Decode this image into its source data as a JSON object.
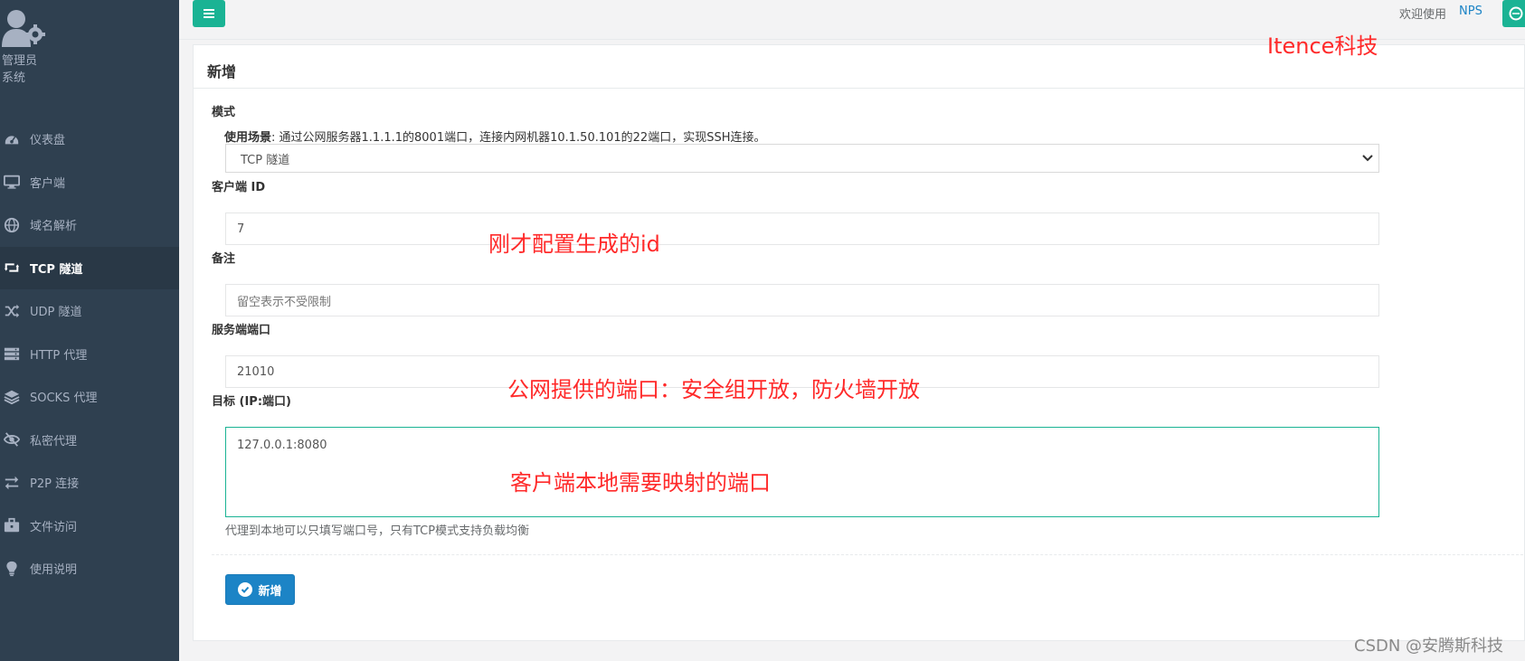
{
  "sidebar": {
    "role_line1": "管理员",
    "role_line2": "系统",
    "items": [
      {
        "label": "仪表盘",
        "icon": "dashboard-icon"
      },
      {
        "label": "客户端",
        "icon": "monitor-icon"
      },
      {
        "label": "域名解析",
        "icon": "globe-icon"
      },
      {
        "label": "TCP 隧道",
        "icon": "retweet-icon"
      },
      {
        "label": "UDP 隧道",
        "icon": "shuffle-icon"
      },
      {
        "label": "HTTP 代理",
        "icon": "server-icon"
      },
      {
        "label": "SOCKS 代理",
        "icon": "layers-icon"
      },
      {
        "label": "私密代理",
        "icon": "eye-slash-icon"
      },
      {
        "label": "P2P 连接",
        "icon": "exchange-icon"
      },
      {
        "label": "文件访问",
        "icon": "briefcase-icon"
      },
      {
        "label": "使用说明",
        "icon": "lightbulb-icon"
      }
    ],
    "active_index": 3
  },
  "topbar": {
    "welcome": "欢迎使用",
    "brand_link": "NPS"
  },
  "panel": {
    "title": "新增",
    "mode_label": "模式",
    "scene_label": "使用场景",
    "scene_text": ": 通过公网服务器1.1.1.1的8001端口，连接内网机器10.1.50.101的22端口，实现SSH连接。",
    "mode_value": "TCP 隧道",
    "client_id_label": "客户端 ID",
    "client_id_value": "7",
    "remark_label": "备注",
    "remark_placeholder": "留空表示不受限制",
    "server_port_label": "服务端端口",
    "server_port_value": "21010",
    "target_label": "目标 (IP:端口)",
    "target_value": "127.0.0.1:8080",
    "target_hint": "代理到本地可以只填写端口号，只有TCP模式支持负载均衡",
    "submit_label": "新增"
  },
  "annotations": {
    "brand": "Itence科技",
    "client_id_note": "刚才配置生成的id",
    "server_port_note": "公网提供的端口：安全组开放，防火墙开放",
    "target_note": "客户端本地需要映射的端口",
    "color": "#ff2a2a"
  },
  "watermark": "CSDN @安腾斯科技",
  "colors": {
    "sidebar_bg": "#2f4050",
    "accent_green": "#1ab394",
    "primary_blue": "#1c84c6"
  }
}
